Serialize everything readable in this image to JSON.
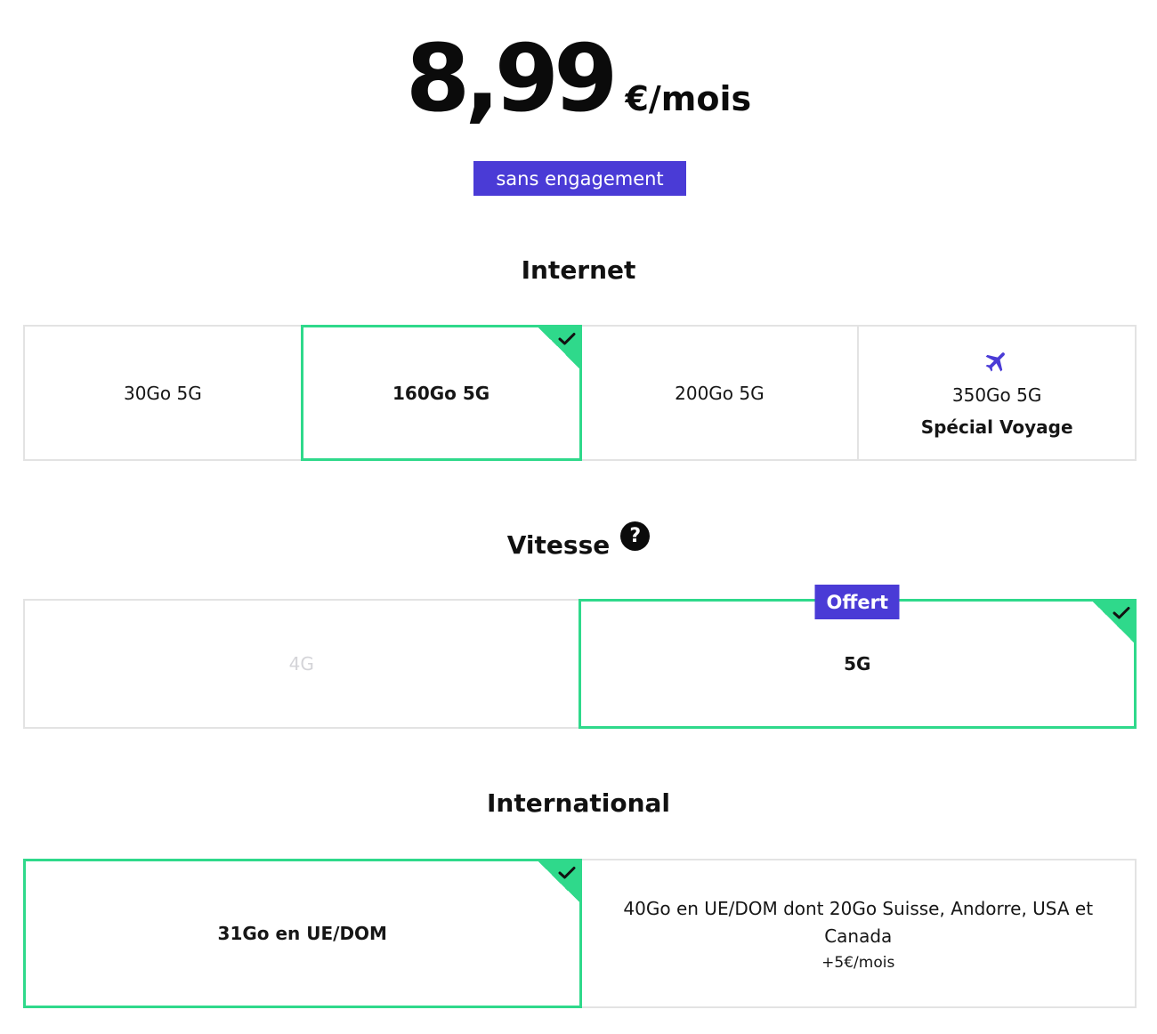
{
  "price": {
    "amount": "8,99",
    "unit": "€/mois"
  },
  "engagement_badge": "sans engagement",
  "internet": {
    "title": "Internet",
    "options": [
      {
        "label": "30Go 5G"
      },
      {
        "label": "160Go 5G",
        "selected": true
      },
      {
        "label": "200Go 5G"
      },
      {
        "label": "350Go 5G",
        "label2": "Spécial Voyage",
        "icon": "plane-icon"
      }
    ]
  },
  "vitesse": {
    "title": "Vitesse",
    "help_icon": "?",
    "options": [
      {
        "label": "4G",
        "disabled": true
      },
      {
        "label": "5G",
        "selected": true,
        "badge": "Offert"
      }
    ]
  },
  "international": {
    "title": "International",
    "options": [
      {
        "label": "31Go en UE/DOM",
        "selected": true
      },
      {
        "label": "40Go en UE/DOM dont 20Go Suisse, Andorre, USA et Canada",
        "sub": "+5€/mois"
      }
    ]
  },
  "colors": {
    "accent_purple": "#4a3bd6",
    "selected_green": "#2fd98b",
    "border_grey": "#e3e3e3"
  }
}
